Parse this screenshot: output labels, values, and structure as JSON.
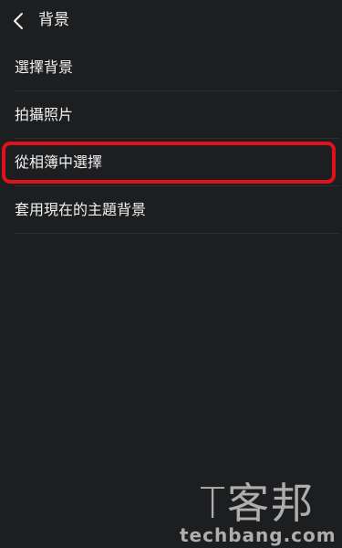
{
  "header": {
    "back_icon": "chevron-left-icon",
    "title": "背景"
  },
  "menu": {
    "items": [
      {
        "label": "選擇背景"
      },
      {
        "label": "拍攝照片"
      },
      {
        "label": "從相簿中選擇"
      },
      {
        "label": "套用現在的主題背景"
      }
    ]
  },
  "highlight": {
    "color": "#e0101c",
    "target_item_index": 2
  },
  "watermark": {
    "logo": "T客邦",
    "url": "techbang.com"
  },
  "colors": {
    "background": "#1d1e20",
    "divider": "#2c2d30",
    "text": "#f0f0f0"
  }
}
